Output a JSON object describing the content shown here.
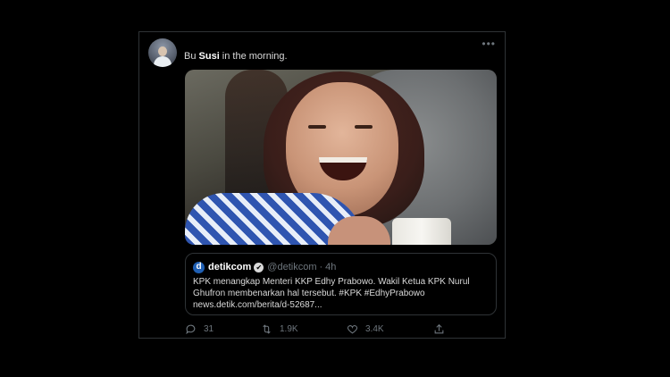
{
  "tweet": {
    "text_prefix": "Bu ",
    "text_bold": "Susi",
    "text_suffix": " in the morning.",
    "more_label": "•••"
  },
  "quote": {
    "logo_letter": "d",
    "name": "detikcom",
    "verified_icon": "✔",
    "handle": "@detikcom",
    "separator": "·",
    "time": "4h",
    "body_line1": "KPK menangkap Menteri KKP Edhy Prabowo. Wakil Ketua KPK Nurul",
    "body_line2": "Ghufron membenarkan hal tersebut. #KPK #EdhyPrabowo",
    "body_line3": "news.detik.com/berita/d-52687..."
  },
  "actions": {
    "reply_count": "31",
    "retweet_count": "1.9K",
    "like_count": "3.4K"
  },
  "icons": {
    "reply": "reply-icon",
    "retweet": "retweet-icon",
    "like": "heart-icon",
    "share": "share-icon"
  },
  "colors": {
    "background": "#000000",
    "border": "#2f3336",
    "muted": "#6e767d",
    "text": "#d9d9d9",
    "detik_blue": "#1f5fb3"
  }
}
